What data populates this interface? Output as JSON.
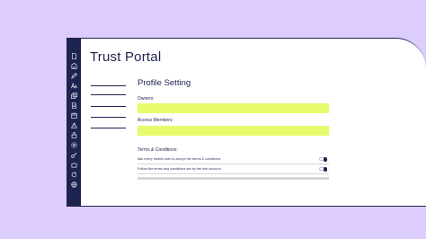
{
  "window": {
    "title": "Trust Portal"
  },
  "sidebar": {
    "icons": [
      "document-icon",
      "building-icon",
      "edit-icon",
      "text-size-icon",
      "copy-icon",
      "file-icon",
      "calendar-icon",
      "warning-icon",
      "lock-icon",
      "settings-icon",
      "key-icon",
      "puzzle-icon",
      "refresh-icon",
      "globe-icon"
    ]
  },
  "profile": {
    "heading": "Profile Setting",
    "owners_label": "Owners:",
    "owners_value": "",
    "access_label": "Access Members:",
    "access_value": "",
    "terms_label": "Terms & Conditions:",
    "toggles": [
      {
        "label": "Ask every invited user to accept the terms & conditions",
        "on": true
      },
      {
        "label": "Follow the terms and conditions set by the hub account",
        "on": true
      }
    ]
  },
  "colors": {
    "background": "#dccdfd",
    "navy": "#1e2250",
    "highlight": "#e8fb6d"
  }
}
